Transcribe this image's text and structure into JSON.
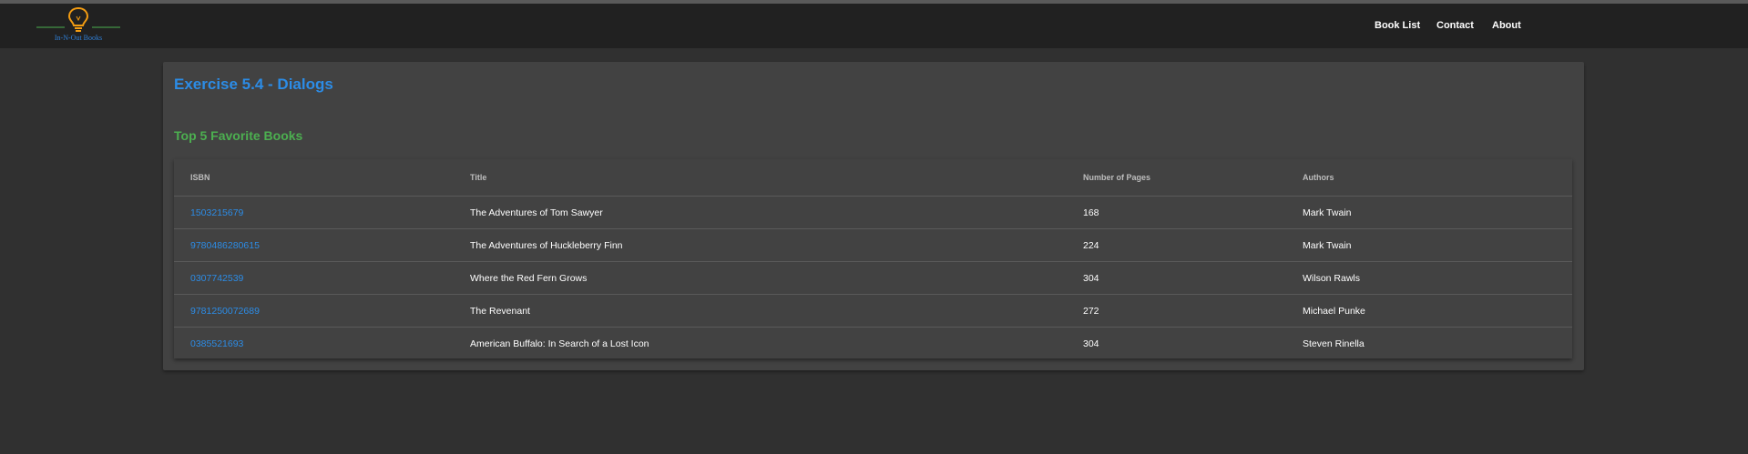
{
  "header": {
    "logo_text": "In-N-Out Books",
    "nav": [
      {
        "label": "Book List"
      },
      {
        "label": "Contact"
      },
      {
        "label": "About"
      }
    ]
  },
  "card": {
    "title": "Exercise 5.4 - Dialogs",
    "section_title": "Top 5 Favorite Books"
  },
  "table": {
    "columns": [
      "ISBN",
      "Title",
      "Number of Pages",
      "Authors"
    ],
    "rows": [
      {
        "isbn": "1503215679",
        "title": "The Adventures of Tom Sawyer",
        "pages": "168",
        "authors": "Mark Twain"
      },
      {
        "isbn": "9780486280615",
        "title": "The Adventures of Huckleberry Finn",
        "pages": "224",
        "authors": "Mark Twain"
      },
      {
        "isbn": "0307742539",
        "title": "Where the Red Fern Grows",
        "pages": "304",
        "authors": "Wilson Rawls"
      },
      {
        "isbn": "9781250072689",
        "title": "The Revenant",
        "pages": "272",
        "authors": "Michael Punke"
      },
      {
        "isbn": "0385521693",
        "title": "American Buffalo: In Search of a Lost Icon",
        "pages": "304",
        "authors": "Steven Rinella"
      }
    ]
  },
  "colors": {
    "accent_blue": "#2c8ce6",
    "accent_green": "#4caf50",
    "logo_orange": "#f39c12",
    "background": "#303030",
    "card": "#424242",
    "navbar": "#212121"
  },
  "icons": {
    "logo": "lightbulb-icon"
  }
}
